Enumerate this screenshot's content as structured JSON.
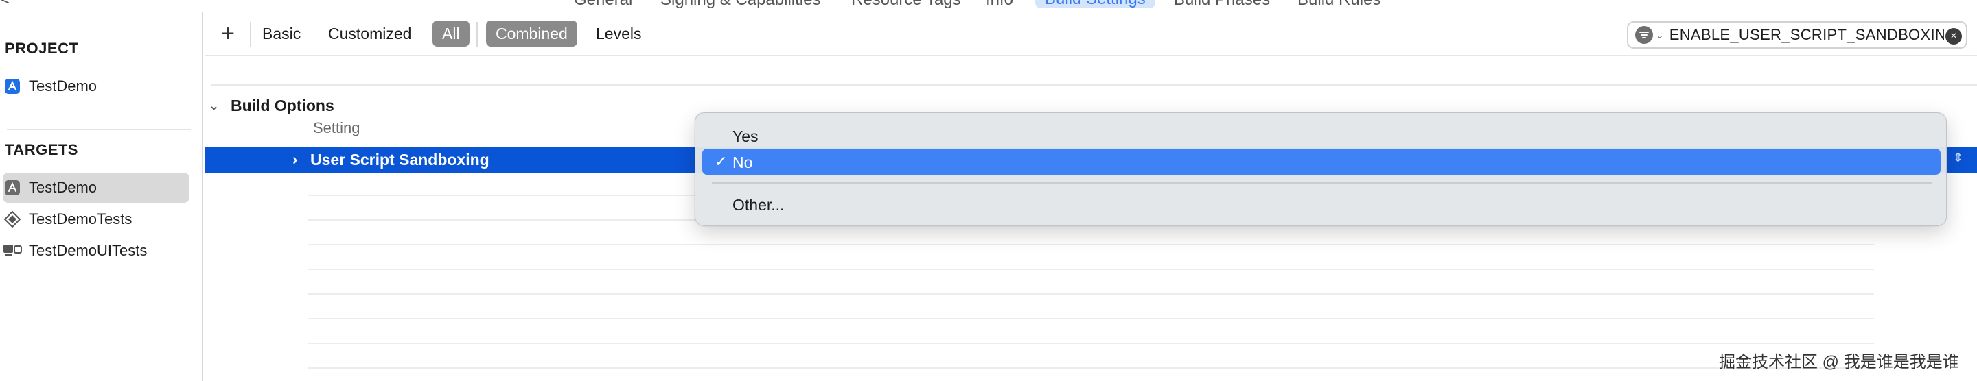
{
  "top_tabs": [
    {
      "label": "General",
      "active": false
    },
    {
      "label": "Signing & Capabilities",
      "active": false
    },
    {
      "label": "Resource Tags",
      "active": false
    },
    {
      "label": "Info",
      "active": false
    },
    {
      "label": "Build Settings",
      "active": true
    },
    {
      "label": "Build Phases",
      "active": false
    },
    {
      "label": "Build Rules",
      "active": false
    }
  ],
  "sidebar": {
    "project_title": "PROJECT",
    "project_items": [
      {
        "label": "TestDemo",
        "icon": "app-project-icon"
      }
    ],
    "targets_title": "TARGETS",
    "target_items": [
      {
        "label": "TestDemo",
        "icon": "app-target-icon",
        "selected": true
      },
      {
        "label": "TestDemoTests",
        "icon": "unit-tests-icon",
        "selected": false
      },
      {
        "label": "TestDemoUITests",
        "icon": "ui-tests-icon",
        "selected": false
      }
    ]
  },
  "toolbar": {
    "add_label": "+",
    "basic_label": "Basic",
    "customized_label": "Customized",
    "all_label": "All",
    "combined_label": "Combined",
    "levels_label": "Levels",
    "search_value": "ENABLE_USER_SCRIPT_SANDBOXING"
  },
  "content": {
    "group_title": "Build Options",
    "column_setting": "Setting",
    "selected_row_label": "User Script Sandboxing"
  },
  "popup": {
    "items": [
      "Yes",
      "No",
      "Other..."
    ],
    "selected": "No"
  },
  "watermark": "掘金技术社区 @ 我是谁是我是谁",
  "colors": {
    "selection_blue": "#0a54d6",
    "menu_highlight": "#3f82f5",
    "tab_active_bg": "#d3e4fb"
  }
}
